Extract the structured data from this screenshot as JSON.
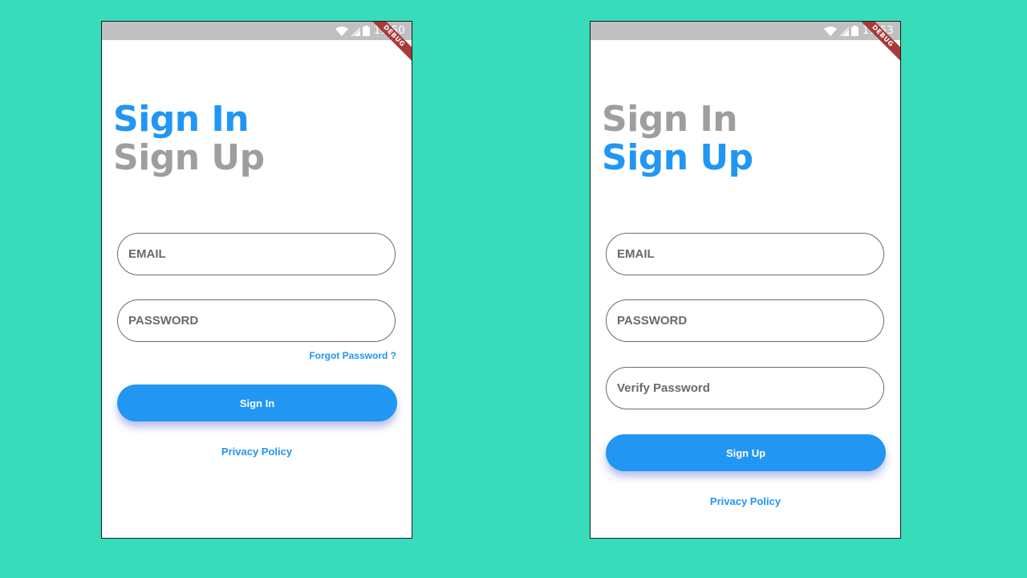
{
  "colors": {
    "background": "#37dcbb",
    "accent": "#2196f3",
    "inactive_title": "#9e9e9e",
    "status_bar": "#c0c0c0",
    "debug_ribbon": "#a83a3a"
  },
  "left_screen": {
    "status_time": "11:50",
    "debug_label": "DEBUG",
    "title_active": "Sign In",
    "title_inactive": "Sign Up",
    "email_placeholder": "EMAIL",
    "password_placeholder": "PASSWORD",
    "forgot_password": "Forgot Password ?",
    "submit_label": "Sign In",
    "privacy_policy": "Privacy Policy"
  },
  "right_screen": {
    "status_time": "11:53",
    "debug_label": "DEBUG",
    "title_inactive": "Sign In",
    "title_active": "Sign Up",
    "email_placeholder": "EMAIL",
    "password_placeholder": "PASSWORD",
    "verify_password_placeholder": "Verify Password",
    "submit_label": "Sign Up",
    "privacy_policy": "Privacy Policy"
  },
  "icons": [
    "wifi-icon",
    "signal-icon",
    "battery-icon"
  ]
}
